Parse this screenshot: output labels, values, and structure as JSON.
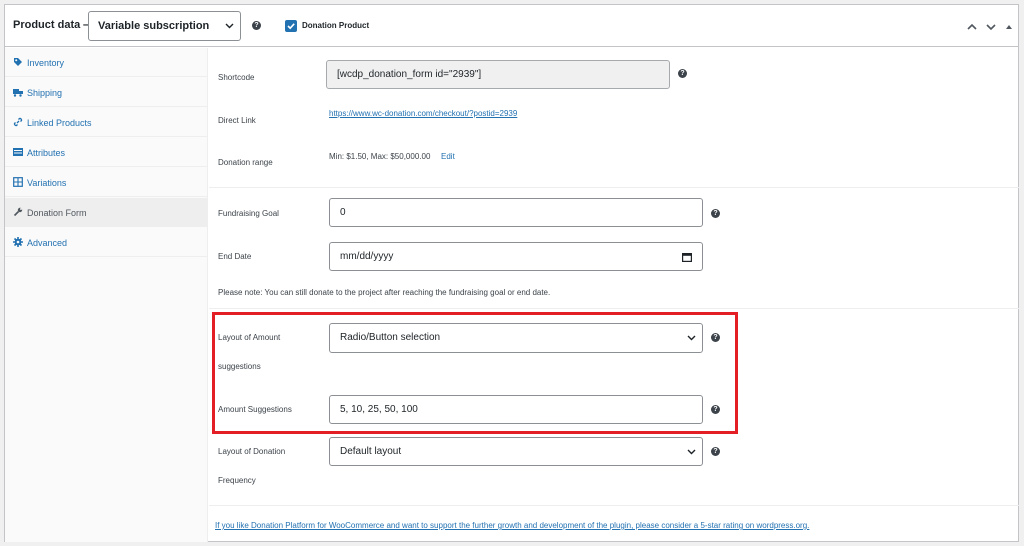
{
  "header": {
    "title": "Product data —",
    "product_type": "Variable subscription",
    "donation_product_label": "Donation Product"
  },
  "sidebar": {
    "items": [
      {
        "label": "Inventory",
        "icon": "tag-icon"
      },
      {
        "label": "Shipping",
        "icon": "truck-icon"
      },
      {
        "label": "Linked Products",
        "icon": "link-icon"
      },
      {
        "label": "Attributes",
        "icon": "list-icon"
      },
      {
        "label": "Variations",
        "icon": "grid-icon"
      },
      {
        "label": "Donation Form",
        "icon": "wrench-icon"
      },
      {
        "label": "Advanced",
        "icon": "gear-icon"
      }
    ]
  },
  "form": {
    "shortcode_label": "Shortcode",
    "shortcode_value": "[wcdp_donation_form id=\"2939\"]",
    "direct_link_label": "Direct Link",
    "direct_link_value": "https://www.wc-donation.com/checkout/?postid=2939",
    "donation_range_label": "Donation range",
    "donation_range_value": "Min: $1.50, Max: $50,000.00",
    "edit_label": "Edit",
    "goal_label": "Fundraising Goal",
    "goal_value": "0",
    "end_date_label": "End Date",
    "end_date_placeholder": "mm/dd/yyyy",
    "note": "Please note: You can still donate to the project after reaching the fundraising goal or end date.",
    "layout_amount_label_1": "Layout of Amount",
    "layout_amount_label_2": "suggestions",
    "layout_amount_value": "Radio/Button selection",
    "amount_suggestions_label": "Amount Suggestions",
    "amount_suggestions_value": "5, 10, 25, 50, 100",
    "layout_frequency_label_1": "Layout of Donation",
    "layout_frequency_label_2": "Frequency",
    "layout_frequency_value": "Default layout",
    "footer_link": "If you like Donation Platform for WooCommerce and want to support the further growth and development of the plugin, please consider a 5-star rating on wordpress.org."
  },
  "colors": {
    "accent": "#2271b1",
    "highlight": "#e31e24"
  }
}
